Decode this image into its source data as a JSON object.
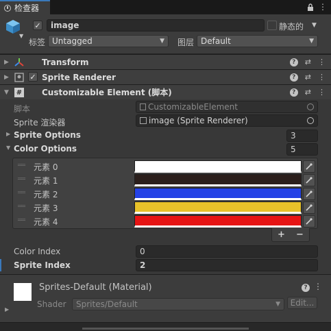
{
  "tab": {
    "title": "检查器"
  },
  "header": {
    "active": true,
    "name": "image",
    "static_label": "静态的",
    "tag_label": "标签",
    "tag_value": "Untagged",
    "layer_label": "图层",
    "layer_value": "Default"
  },
  "components": [
    {
      "title": "Transform"
    },
    {
      "title": "Sprite Renderer",
      "enabled": true
    },
    {
      "title": "Customizable Element  (脚本)"
    }
  ],
  "script": {
    "script_label": "脚本",
    "script_value": "CustomizableElement",
    "sprite_label": "Sprite 渲染器",
    "sprite_value": "image (Sprite Renderer)",
    "sprite_options_label": "Sprite Options",
    "sprite_options_count": "3",
    "color_options_label": "Color Options",
    "color_options_count": "5",
    "colors": [
      {
        "label": "元素 0",
        "hex": "#ffffff"
      },
      {
        "label": "元素 1",
        "hex": "#2b1f1c"
      },
      {
        "label": "元素 2",
        "hex": "#2442e6"
      },
      {
        "label": "元素 3",
        "hex": "#e8c22a"
      },
      {
        "label": "元素 4",
        "hex": "#e61414"
      }
    ],
    "add_symbol": "+",
    "remove_symbol": "−",
    "color_index_label": "Color Index",
    "color_index_value": "0",
    "sprite_index_label": "Sprite Index",
    "sprite_index_value": "2"
  },
  "material": {
    "title": "Sprites-Default (Material)",
    "shader_label": "Shader",
    "shader_value": "Sprites/Default",
    "edit_label": "Edit..."
  }
}
